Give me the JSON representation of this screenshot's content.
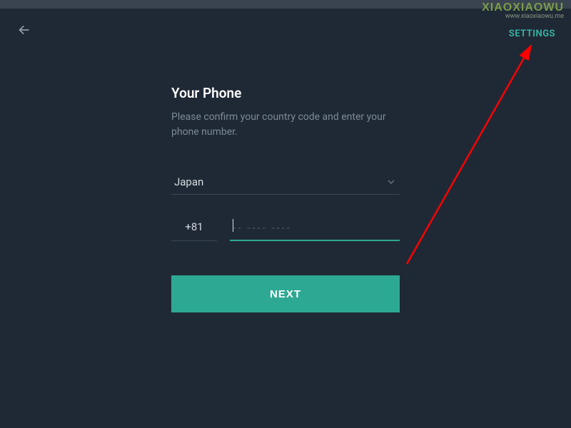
{
  "watermark": {
    "main": "XIAOXIAOWU",
    "sub": "www.xiaoxiaowu.me"
  },
  "header": {
    "settings_label": "SETTINGS"
  },
  "form": {
    "title": "Your Phone",
    "subtitle": "Please confirm your country code and enter your phone number.",
    "country_selected": "Japan",
    "country_code": "+81",
    "phone_value": "",
    "phone_placeholder": "-- ---- ----",
    "next_label": "NEXT"
  }
}
